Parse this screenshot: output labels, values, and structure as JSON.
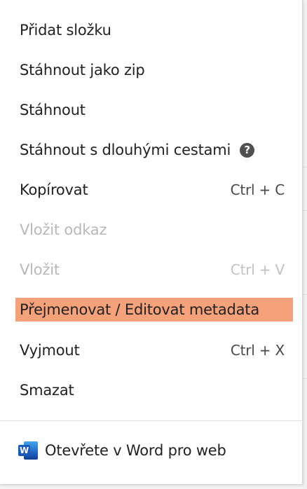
{
  "context_menu": {
    "items": [
      {
        "label": "Přidat složku",
        "shortcut": "",
        "disabled": false
      },
      {
        "label": "Stáhnout jako zip",
        "shortcut": "",
        "disabled": false
      },
      {
        "label": "Stáhnout",
        "shortcut": "",
        "disabled": false
      },
      {
        "label": "Stáhnout s dlouhými cestami",
        "shortcut": "",
        "disabled": false,
        "icon": "help-icon",
        "icon_glyph": "?"
      },
      {
        "label": "Kopírovat",
        "shortcut": "Ctrl + C",
        "disabled": false
      },
      {
        "label": "Vložit odkaz",
        "shortcut": "",
        "disabled": true
      },
      {
        "label": "Vložit",
        "shortcut": "Ctrl + V",
        "disabled": true
      },
      {
        "label": "Přejmenovat / Editovat metadata",
        "shortcut": "",
        "disabled": false,
        "highlighted": true
      },
      {
        "label": "Vyjmout",
        "shortcut": "Ctrl + X",
        "disabled": false
      },
      {
        "label": "Smazat",
        "shortcut": "",
        "disabled": false
      }
    ],
    "open_in": {
      "label": "Otevřete v Word pro web",
      "icon": "word-icon",
      "icon_letter": "W"
    }
  },
  "colors": {
    "highlight": "#f5a27b",
    "text": "#222222",
    "disabled_text": "#b8b8b8",
    "word_blue": "#185abd"
  }
}
